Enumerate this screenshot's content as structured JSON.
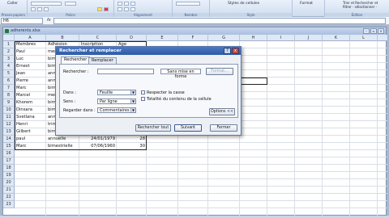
{
  "ribbon": {
    "paste_group": "Presse-papiers",
    "copy_label": "Coller",
    "font_group": "Police",
    "align_group": "Alignement",
    "number_group": "Nombre",
    "styles_group": "Style",
    "cell_styles": "Styles de cellules",
    "format_label": "Format",
    "editing_group": "Édition",
    "sort_label": "Trier et Rechercher et",
    "filter_label": "filtrer · sélectionner ·"
  },
  "formula_bar": {
    "name_box": "H6",
    "fx": "fx",
    "value": ""
  },
  "workbook": {
    "title": "adherents.xlsx",
    "columns": [
      "A",
      "B",
      "C",
      "D",
      "E",
      "F",
      "G",
      "H",
      "I",
      "J",
      "K",
      "L",
      "M",
      "N"
    ],
    "rows": [
      "1",
      "2",
      "3",
      "4",
      "5",
      "6",
      "7",
      "8",
      "9",
      "10",
      "11",
      "12",
      "13",
      "14",
      "15",
      "16",
      "17",
      "18",
      "19",
      "20",
      "21",
      "22",
      "23"
    ],
    "data": [
      [
        "Membres",
        "Adhésion",
        "Inscription",
        "Age"
      ],
      [
        "Paul",
        "mensuelle",
        "",
        ""
      ],
      [
        "Luc",
        "bim",
        "",
        ""
      ],
      [
        "Ernest",
        "bim",
        "",
        ""
      ],
      [
        "Jean",
        "ann",
        "",
        ""
      ],
      [
        "Pierre",
        "ann",
        "",
        ""
      ],
      [
        "Marc",
        "bim",
        "",
        ""
      ],
      [
        "Marcel",
        "men",
        "",
        ""
      ],
      [
        "Khorem",
        "bim",
        "",
        ""
      ],
      [
        "Dinsara",
        "bim",
        "",
        ""
      ],
      [
        "Svetlana",
        "ann",
        "",
        ""
      ],
      [
        "Henri",
        "trim",
        "",
        ""
      ],
      [
        "Gilbert",
        "bimestrielle",
        "28/01/1987",
        "20"
      ],
      [
        "paul",
        "annuelle",
        "24/01/1979",
        "28"
      ],
      [
        "Marc",
        "bimestrielle",
        "07/06/1960",
        "30"
      ]
    ]
  },
  "dialog": {
    "title": "Rechercher et remplacer",
    "help": "?",
    "close": "x",
    "tab_find": "Rechercher",
    "tab_replace": "Remplacer",
    "find_label": "Rechercher :",
    "find_value": "",
    "no_format": "Sans mise en forme",
    "format_button": "Format...",
    "within_label": "Dans :",
    "within_value": "Feuille",
    "search_label": "Sens :",
    "search_value": "Par ligne",
    "lookin_label": "Regarder dans :",
    "lookin_value": "Commentaires",
    "match_case": "Respecter la casse",
    "match_entire": "Totalité du contenu de la cellule",
    "options_button": "Options <<",
    "find_all": "Rechercher tout",
    "find_next": "Suivant",
    "close_button": "Fermer"
  }
}
